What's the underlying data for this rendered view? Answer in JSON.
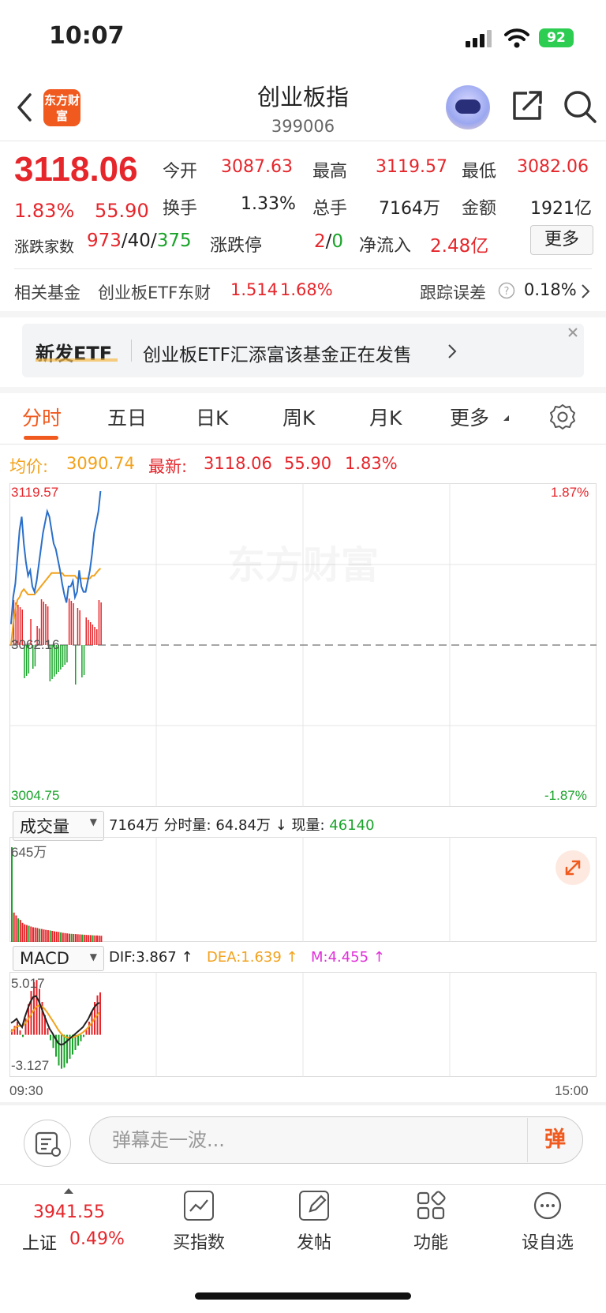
{
  "status_bar": {
    "time": "10:07",
    "battery": "92"
  },
  "header": {
    "title": "创业板指",
    "code": "399006",
    "logo_text": "东方财富"
  },
  "quote": {
    "price": "3118.06",
    "change_pct": "1.83%",
    "change": "55.90",
    "open_label": "今开",
    "open": "3087.63",
    "high_label": "最高",
    "high": "3119.57",
    "low_label": "最低",
    "low": "3082.06",
    "turnover_label": "换手",
    "turnover": "1.33%",
    "volume_label": "总手",
    "volume": "7164万",
    "amount_label": "金额",
    "amount": "1921亿",
    "breadth_label": "涨跌家数",
    "breadth_up": "973",
    "breadth_flat": "40",
    "breadth_down": "375",
    "sep": "/",
    "limit_label": "涨跌停",
    "limit_up": "2",
    "limit_down": "0",
    "inflow_label": "净流入",
    "inflow": "2.48亿",
    "more_label": "更多"
  },
  "fund": {
    "label": "相关基金",
    "name": "创业板ETF东财",
    "price": "1.514",
    "pct": "1.68%",
    "track_label": "跟踪误差",
    "track_value": "0.18%"
  },
  "banner": {
    "tag": "新发ETF",
    "text": "创业板ETF汇添富该基金正在发售"
  },
  "tabs": [
    "分时",
    "五日",
    "日K",
    "周K",
    "月K",
    "更多"
  ],
  "info_line": {
    "avg_label": "均价:",
    "avg": "3090.74",
    "latest_label": "最新:",
    "latest": "3118.06",
    "chg": "55.90",
    "pct": "1.83%"
  },
  "price_chart": {
    "y_top": "3119.57",
    "y_mid": "3062.16",
    "y_bottom": "3004.75",
    "pct_top": "1.87%",
    "pct_bottom": "-1.87%",
    "watermark": "东方财富"
  },
  "volume_panel": {
    "selector": "成交量",
    "total": "7164万",
    "minute_label": "分时量:",
    "minute": "64.84万",
    "arrow": "↓",
    "now_label": "现量:",
    "now": "46140",
    "y_top": "645万"
  },
  "macd_panel": {
    "selector": "MACD",
    "dif": "DIF:3.867 ↑",
    "dea": "DEA:1.639 ↑",
    "m": "M:4.455 ↑",
    "y_top": "5.017",
    "y_bottom": "-3.127",
    "time_start": "09:30",
    "time_end": "15:00"
  },
  "danmu": {
    "placeholder": "弹幕走一波...",
    "button": "弹"
  },
  "tabbar": {
    "index_price": "3941.55",
    "index_name": "上证",
    "index_pct": "0.49%",
    "items": [
      "买指数",
      "发帖",
      "功能",
      "设自选"
    ]
  },
  "colors": {
    "up": "#e5262b",
    "down": "#1aa32a",
    "avg": "#f2a21c",
    "price_line": "#2a6fc9",
    "accent": "#f05a1e"
  },
  "chart_data": [
    {
      "type": "line",
      "series": [
        {
          "values": [
            3070,
            3080,
            3085,
            3095,
            3105,
            3110,
            3100,
            3093,
            3088,
            3090,
            3084,
            3082,
            3086,
            3092,
            3098,
            3104,
            3108,
            3112,
            3110,
            3105,
            3100,
            3098,
            3094,
            3090,
            3085,
            3081,
            3078,
            3084,
            3084,
            3086,
            3080,
            3082,
            3090,
            3084,
            3082,
            3082,
            3086,
            3090,
            3096,
            3104,
            3108,
            3112,
            3119.57
          ]
        },
        {
          "values": [
            3062,
            3070,
            3075,
            3079,
            3080,
            3082,
            3083,
            3082,
            3081,
            3081,
            3081,
            3081,
            3082,
            3083,
            3084,
            3085,
            3086,
            3087,
            3088,
            3089,
            3089,
            3089,
            3089,
            3089,
            3089,
            3088,
            3088,
            3088,
            3088,
            3088,
            3088,
            3087,
            3087,
            3087,
            3087,
            3087,
            3087,
            3087,
            3088,
            3088,
            3089,
            3090,
            3090.74
          ]
        }
      ],
      "ylim": [
        3004.75,
        3119.57
      ]
    },
    {
      "type": "bar",
      "values": [
        645,
        200,
        180,
        160,
        150,
        130,
        120,
        115,
        110,
        105,
        100,
        98,
        95,
        90,
        88,
        85,
        82,
        80,
        78,
        75,
        72,
        70,
        68,
        65,
        62,
        60,
        58,
        56,
        55,
        54,
        53,
        52,
        51,
        50,
        49,
        48,
        47,
        46,
        45,
        44,
        44,
        43,
        42
      ],
      "ylabel": "万"
    },
    {
      "type": "bar",
      "values": [
        0.5,
        0.8,
        1.2,
        0.4,
        -0.2,
        1.5,
        2.8,
        4.0,
        4.8,
        5.0,
        4.2,
        3.0,
        1.8,
        0.6,
        -0.5,
        -1.2,
        -2.0,
        -2.8,
        -3.1,
        -3.0,
        -2.6,
        -2.2,
        -1.8,
        -1.4,
        -1.0,
        -0.6,
        -0.2,
        0.5,
        1.2,
        2.2,
        3.0,
        3.6,
        3.87
      ],
      "ylim": [
        -3.127,
        5.017
      ]
    }
  ]
}
